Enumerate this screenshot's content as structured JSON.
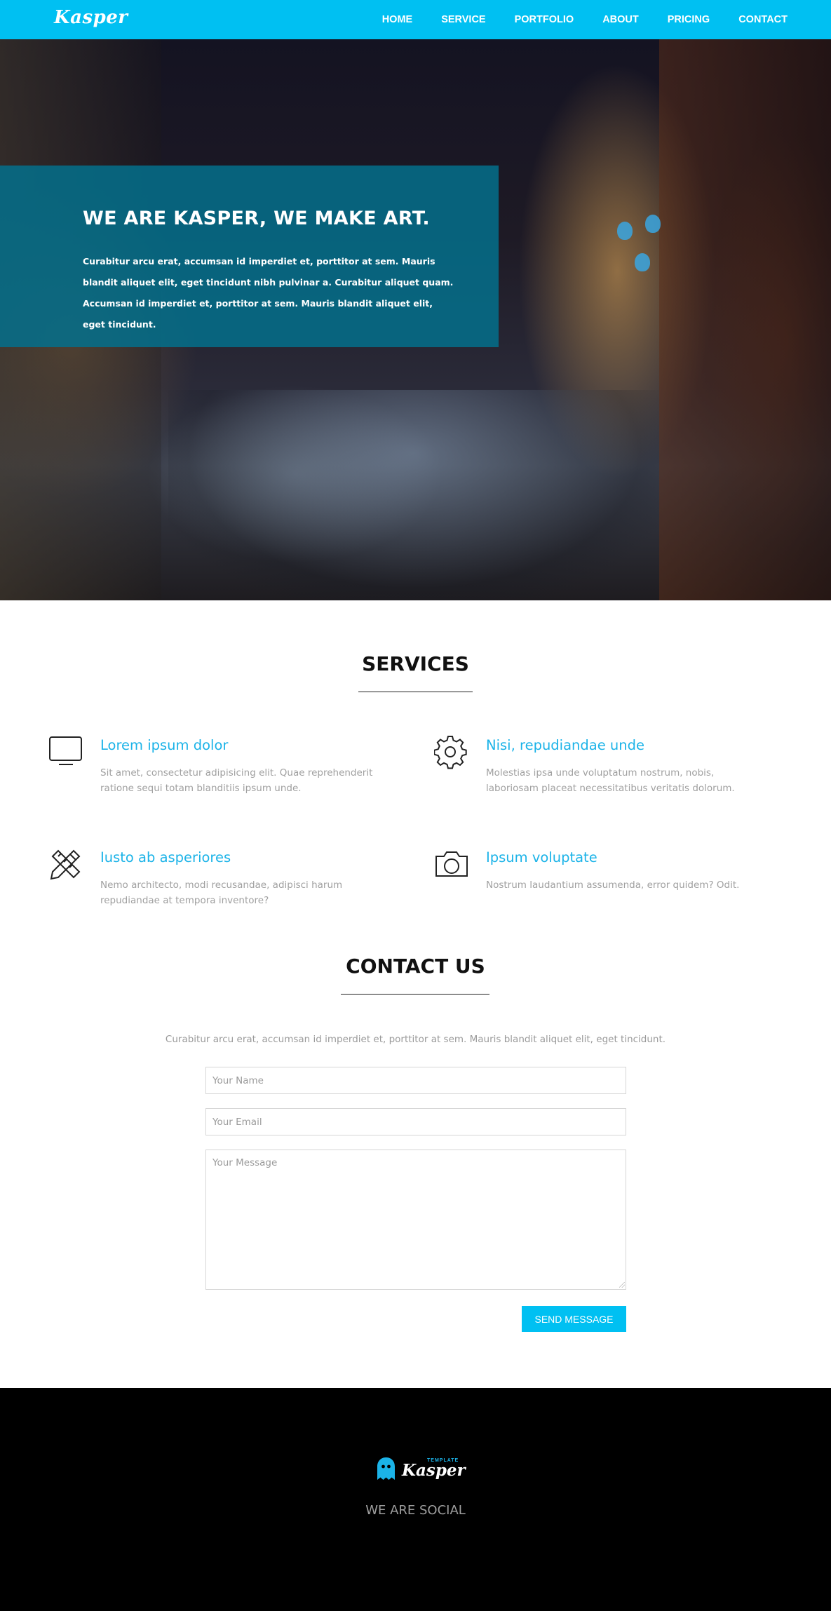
{
  "nav": {
    "logo": "Kasper",
    "items": [
      {
        "label": "HOME"
      },
      {
        "label": "SERVICE"
      },
      {
        "label": "PORTFOLIO"
      },
      {
        "label": "ABOUT"
      },
      {
        "label": "PRICING"
      },
      {
        "label": "CONTACT"
      }
    ]
  },
  "hero": {
    "title": "WE ARE KASPER, WE MAKE ART.",
    "text": "Curabitur arcu erat, accumsan id imperdiet et, porttitor at sem. Mauris blandit aliquet elit, eget tincidunt nibh pulvinar a. Curabitur aliquet quam. Accumsan id imperdiet et, porttitor at sem. Mauris blandit aliquet elit, eget tincidunt."
  },
  "services": {
    "title": "SERVICES",
    "items": [
      {
        "icon": "monitor-icon",
        "title": "Lorem ipsum dolor",
        "text": "Sit amet, consectetur adipisicing elit. Quae reprehenderit ratione sequi totam blanditiis ipsum unde."
      },
      {
        "icon": "gear-icon",
        "title": "Nisi, repudiandae unde",
        "text": "Molestias ipsa unde voluptatum nostrum, nobis, laboriosam placeat necessitatibus veritatis dolorum."
      },
      {
        "icon": "pencil-ruler-icon",
        "title": "Iusto ab asperiores",
        "text": "Nemo architecto, modi recusandae, adipisci harum repudiandae at tempora inventore?"
      },
      {
        "icon": "camera-icon",
        "title": "Ipsum voluptate",
        "text": "Nostrum laudantium assumenda, error quidem? Odit."
      }
    ]
  },
  "contact": {
    "title": "CONTACT US",
    "intro": "Curabitur arcu erat, accumsan id imperdiet et, porttitor at sem. Mauris blandit aliquet elit, eget tincidunt.",
    "name_placeholder": "Your Name",
    "email_placeholder": "Your Email",
    "message_placeholder": "Your Message",
    "send_label": "SEND MESSAGE"
  },
  "footer": {
    "logo_tag": "TEMPLATE",
    "logo_text": "Kasper",
    "logo_icon": "ghost-icon",
    "social_title": "WE ARE SOCIAL"
  },
  "colors": {
    "accent": "#00c0f2",
    "service_title": "#1bb3e8",
    "hero_overlay": "#04708c",
    "footer_bg": "#000000",
    "muted_text": "#a0a0a0"
  }
}
